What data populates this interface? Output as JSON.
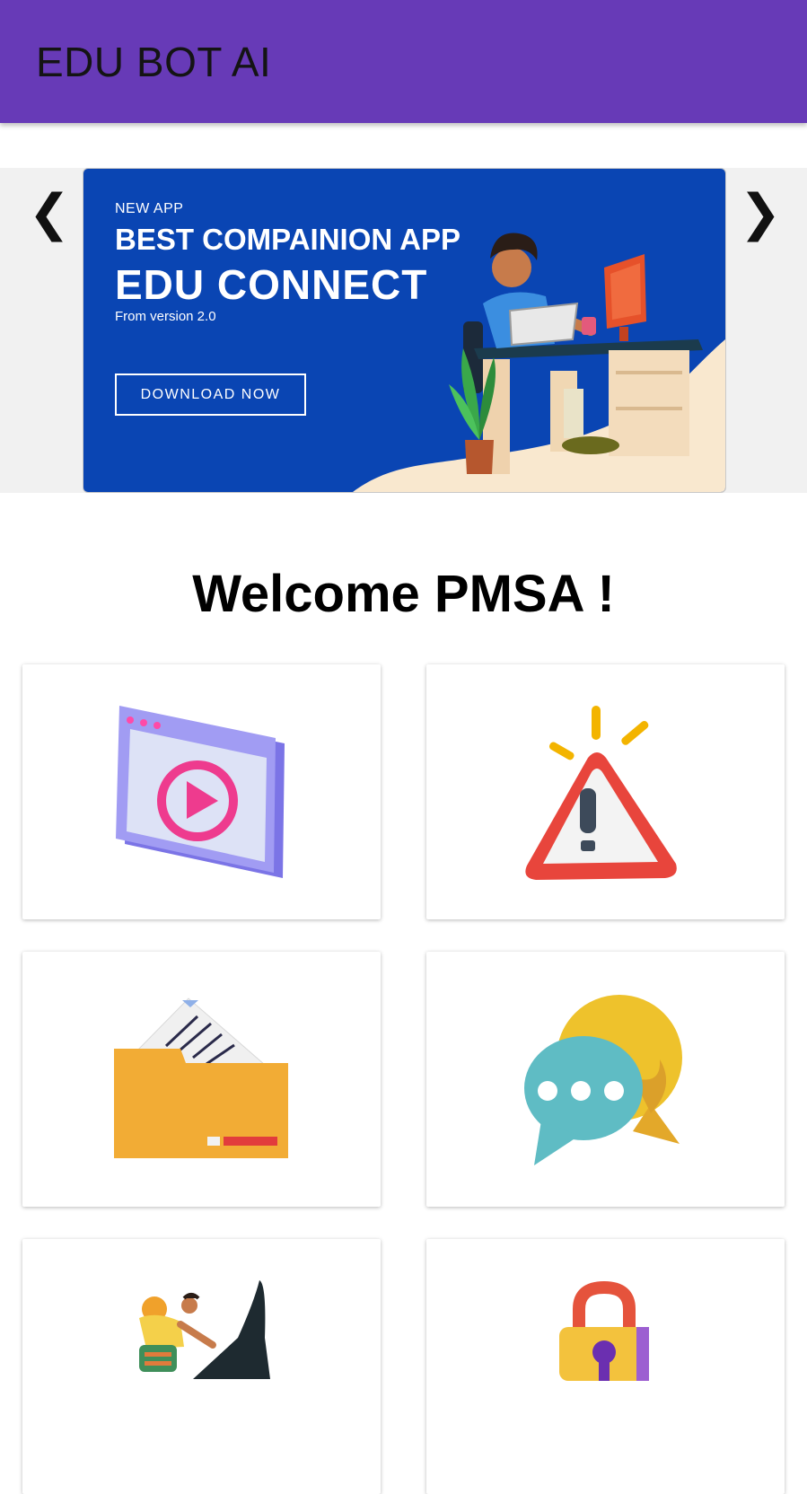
{
  "app_bar": {
    "title": "EDU BOT AI",
    "color": "#673ab7"
  },
  "carousel": {
    "prev_glyph": "❮",
    "next_glyph": "❯",
    "banner": {
      "tag": "NEW APP",
      "headline": "BEST COMPAINION APP",
      "app_name": "EDU CONNECT",
      "subtitle": "From version 2.0",
      "button_label": "DOWNLOAD NOW",
      "background": "#0a45b3"
    }
  },
  "welcome_text": "Welcome PMSA !",
  "tiles": [
    {
      "icon": "video-player-icon"
    },
    {
      "icon": "warning-icon"
    },
    {
      "icon": "folder-icon"
    },
    {
      "icon": "chat-bubbles-icon"
    },
    {
      "icon": "climber-icon"
    },
    {
      "icon": "lock-icon"
    }
  ]
}
